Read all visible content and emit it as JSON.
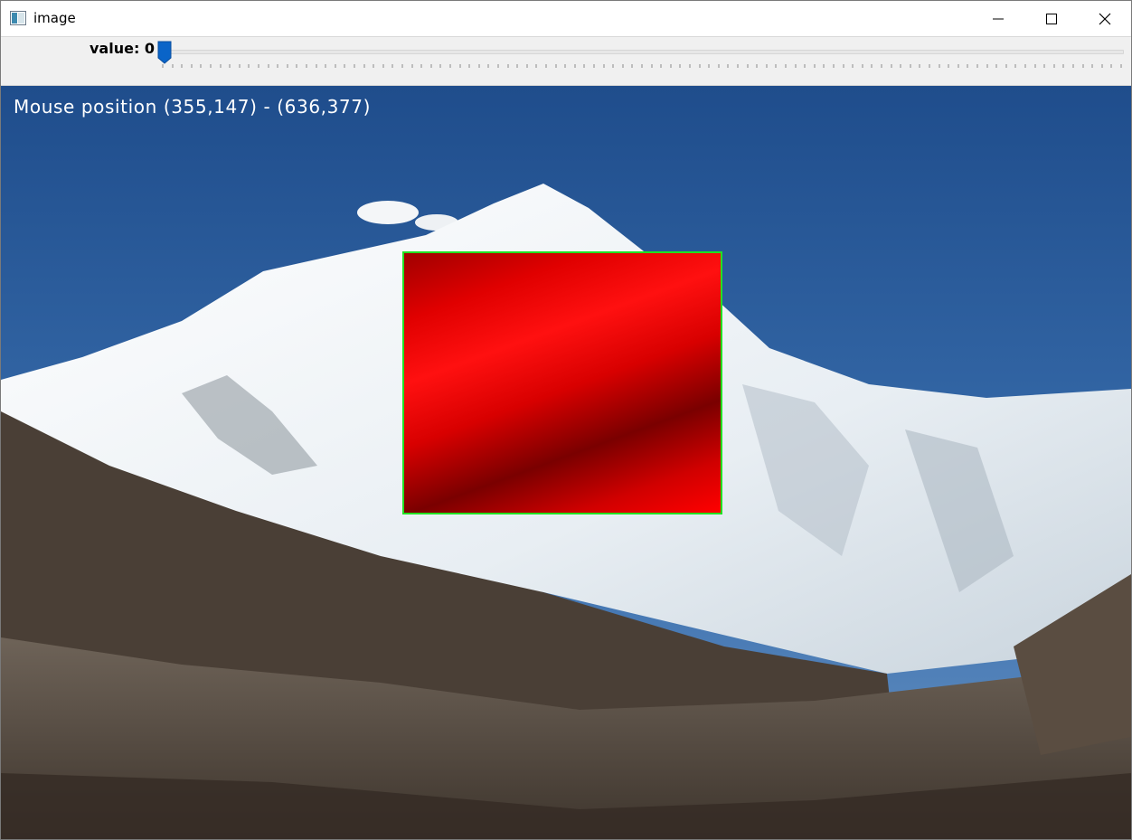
{
  "window": {
    "title": "image",
    "icon": "app-window-icon",
    "controls": [
      "minimize-icon",
      "maximize-icon",
      "close-icon"
    ]
  },
  "trackbar": {
    "label": "value",
    "value": "0",
    "min": 0,
    "thumb_color": "#0a64c8"
  },
  "overlay": {
    "text": "Mouse position (355,147) - (636,377)",
    "color": "#ffffff"
  },
  "selection": {
    "border_color": "#22e022",
    "fill_color": "#ff0000"
  }
}
